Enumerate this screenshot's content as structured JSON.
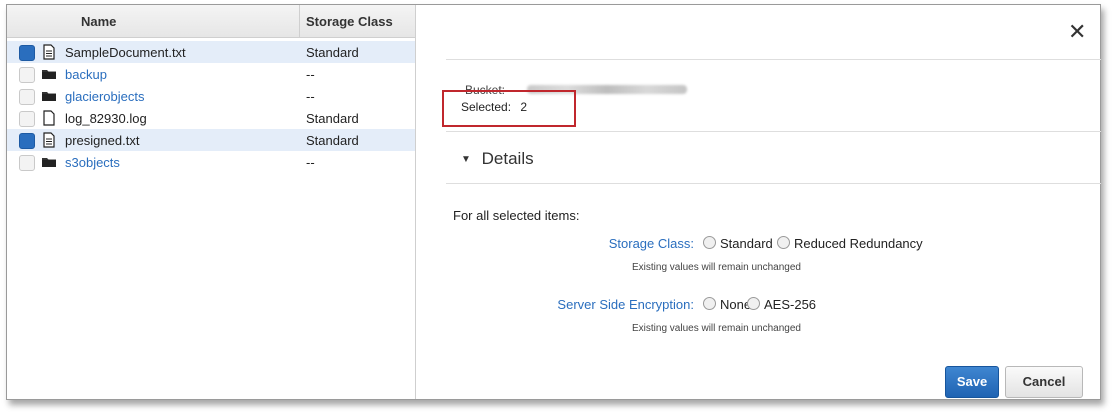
{
  "file_list": {
    "columns": {
      "name": "Name",
      "storage_class": "Storage Class"
    },
    "rows": [
      {
        "name": "SampleDocument.txt",
        "storage_class": "Standard",
        "type": "file",
        "checked": true,
        "icon": "document-icon"
      },
      {
        "name": "backup",
        "storage_class": "--",
        "type": "folder",
        "checked": false,
        "icon": "folder-icon"
      },
      {
        "name": "glacierobjects",
        "storage_class": "--",
        "type": "folder",
        "checked": false,
        "icon": "folder-icon"
      },
      {
        "name": "log_82930.log",
        "storage_class": "Standard",
        "type": "file",
        "checked": false,
        "icon": "file-icon"
      },
      {
        "name": "presigned.txt",
        "storage_class": "Standard",
        "type": "file",
        "checked": true,
        "icon": "document-icon"
      },
      {
        "name": "s3objects",
        "storage_class": "--",
        "type": "folder",
        "checked": false,
        "icon": "folder-icon"
      }
    ]
  },
  "panel": {
    "close_glyph": "✕",
    "bucket_label": "Bucket:",
    "selected_label": "Selected:",
    "selected_count": "2",
    "details_caret": "▼",
    "details_title": "Details",
    "for_all_text": "For all selected items:",
    "storage_class": {
      "label": "Storage Class:",
      "options": [
        "Standard",
        "Reduced Redundancy"
      ],
      "hint": "Existing values will remain unchanged"
    },
    "encryption": {
      "label": "Server Side Encryption:",
      "options": [
        "None",
        "AES-256"
      ],
      "hint": "Existing values will remain unchanged"
    },
    "save_label": "Save",
    "cancel_label": "Cancel"
  },
  "colors": {
    "accent": "#2a6ebe",
    "selected_row": "#e4edf9",
    "highlight_box": "#c0272d"
  }
}
